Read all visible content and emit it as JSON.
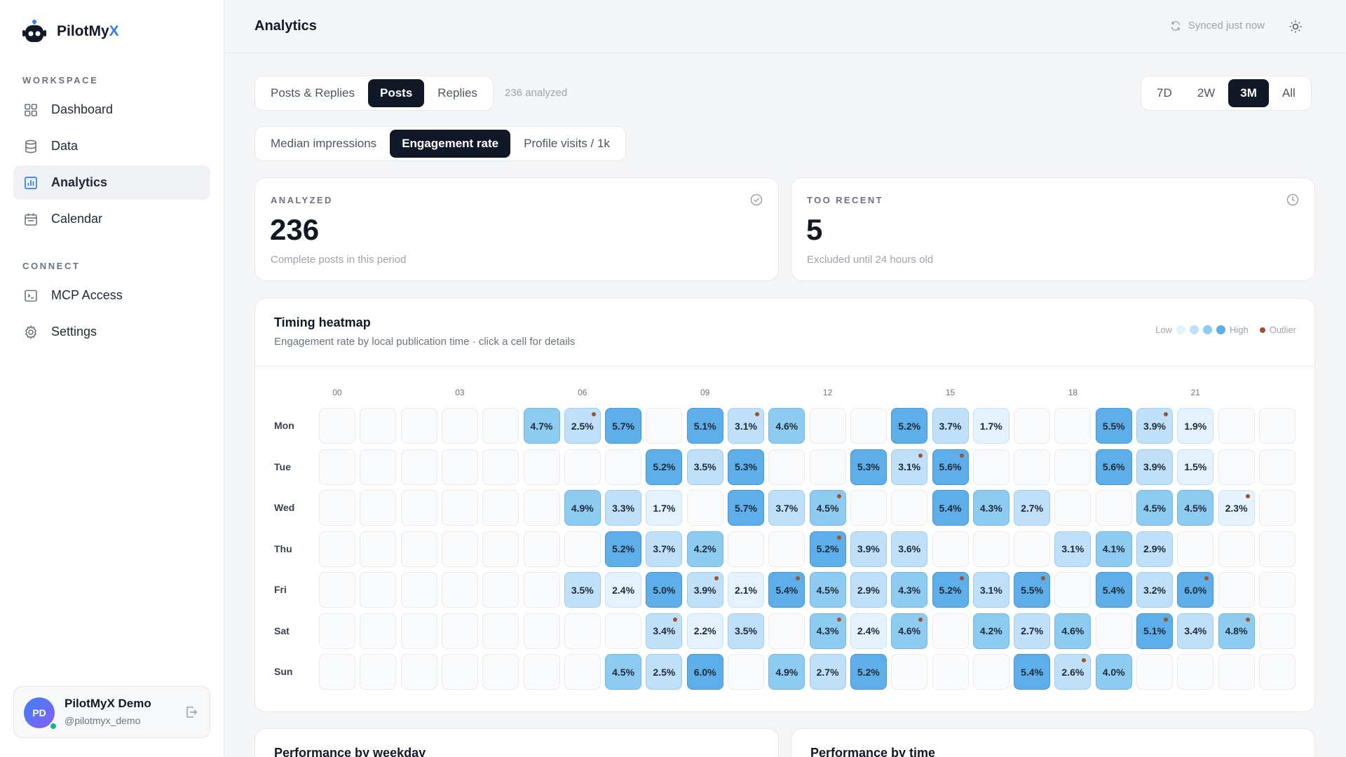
{
  "brand": {
    "name": "PilotMy",
    "accent": "X"
  },
  "sidebar": {
    "workspace_label": "WORKSPACE",
    "connect_label": "CONNECT",
    "workspace_items": [
      {
        "label": "Dashboard",
        "icon": "grid-icon"
      },
      {
        "label": "Data",
        "icon": "database-icon"
      },
      {
        "label": "Analytics",
        "icon": "chart-icon",
        "active": true
      },
      {
        "label": "Calendar",
        "icon": "calendar-icon"
      }
    ],
    "connect_items": [
      {
        "label": "MCP Access",
        "icon": "terminal-icon"
      },
      {
        "label": "Settings",
        "icon": "gear-icon"
      }
    ]
  },
  "user": {
    "initials": "PD",
    "name": "PilotMyX Demo",
    "handle": "@pilotmyx_demo"
  },
  "header": {
    "title": "Analytics",
    "sync_status": "Synced just now"
  },
  "filters": {
    "content_types": [
      "Posts & Replies",
      "Posts",
      "Replies"
    ],
    "content_active": 1,
    "analyzed_text": "236 analyzed",
    "ranges": [
      "7D",
      "2W",
      "3M",
      "All"
    ],
    "range_active": 2,
    "metrics": [
      "Median impressions",
      "Engagement rate",
      "Profile visits / 1k"
    ],
    "metric_active": 1
  },
  "stats": {
    "analyzed": {
      "label": "ANALYZED",
      "value": "236",
      "sub": "Complete posts in this period"
    },
    "too_recent": {
      "label": "TOO RECENT",
      "value": "5",
      "sub": "Excluded until 24 hours old"
    }
  },
  "heatmap": {
    "title": "Timing heatmap",
    "subtitle": "Engagement rate by local publication time · click a cell for details",
    "legend": {
      "low": "Low",
      "high": "High",
      "outlier": "Outlier"
    },
    "colors": {
      "l1": "#e3f2fd",
      "l2": "#bfe0f8",
      "l3": "#8ecbf1",
      "l4": "#5daee9",
      "outlier": "#a0522d"
    },
    "hour_labels": [
      "00",
      "03",
      "06",
      "09",
      "12",
      "15",
      "18",
      "21"
    ],
    "days": [
      "Mon",
      "Tue",
      "Wed",
      "Thu",
      "Fri",
      "Sat",
      "Sun"
    ],
    "rows": [
      [
        null,
        null,
        null,
        null,
        null,
        "4.7%",
        "2.5%*",
        "5.7%",
        null,
        "5.1%",
        "3.1%*",
        "4.6%",
        null,
        null,
        "5.2%",
        "3.7%",
        "1.7%",
        null,
        null,
        "5.5%",
        "3.9%*",
        "1.9%",
        null,
        null
      ],
      [
        null,
        null,
        null,
        null,
        null,
        null,
        null,
        null,
        "5.2%",
        "3.5%",
        "5.3%",
        null,
        null,
        "5.3%",
        "3.1%*",
        "5.6%*",
        null,
        null,
        null,
        "5.6%",
        "3.9%",
        "1.5%",
        null,
        null
      ],
      [
        null,
        null,
        null,
        null,
        null,
        null,
        "4.9%",
        "3.3%",
        "1.7%",
        null,
        "5.7%",
        "3.7%",
        "4.5%*",
        null,
        null,
        "5.4%",
        "4.3%",
        "2.7%",
        null,
        null,
        "4.5%",
        "4.5%",
        "2.3%*",
        null
      ],
      [
        null,
        null,
        null,
        null,
        null,
        null,
        null,
        "5.2%",
        "3.7%",
        "4.2%",
        null,
        null,
        "5.2%*",
        "3.9%",
        "3.6%",
        null,
        null,
        null,
        "3.1%",
        "4.1%",
        "2.9%",
        null,
        null,
        null
      ],
      [
        null,
        null,
        null,
        null,
        null,
        null,
        "3.5%",
        "2.4%",
        "5.0%",
        "3.9%*",
        "2.1%",
        "5.4%*",
        "4.5%",
        "2.9%",
        "4.3%",
        "5.2%*",
        "3.1%",
        "5.5%*",
        null,
        "5.4%",
        "3.2%",
        "6.0%*",
        null,
        null
      ],
      [
        null,
        null,
        null,
        null,
        null,
        null,
        null,
        null,
        "3.4%*",
        "2.2%",
        "3.5%",
        null,
        "4.3%*",
        "2.4%",
        "4.6%*",
        null,
        "4.2%",
        "2.7%",
        "4.6%",
        null,
        "5.1%*",
        "3.4%",
        "4.8%*",
        null
      ],
      [
        null,
        null,
        null,
        null,
        null,
        null,
        null,
        "4.5%",
        "2.5%",
        "6.0%",
        null,
        "4.9%",
        "2.7%",
        "5.2%",
        null,
        null,
        null,
        "5.4%",
        "2.6%*",
        "4.0%",
        null,
        null,
        null,
        null
      ]
    ]
  },
  "sections": {
    "weekday": "Performance by weekday",
    "time": "Performance by time"
  }
}
